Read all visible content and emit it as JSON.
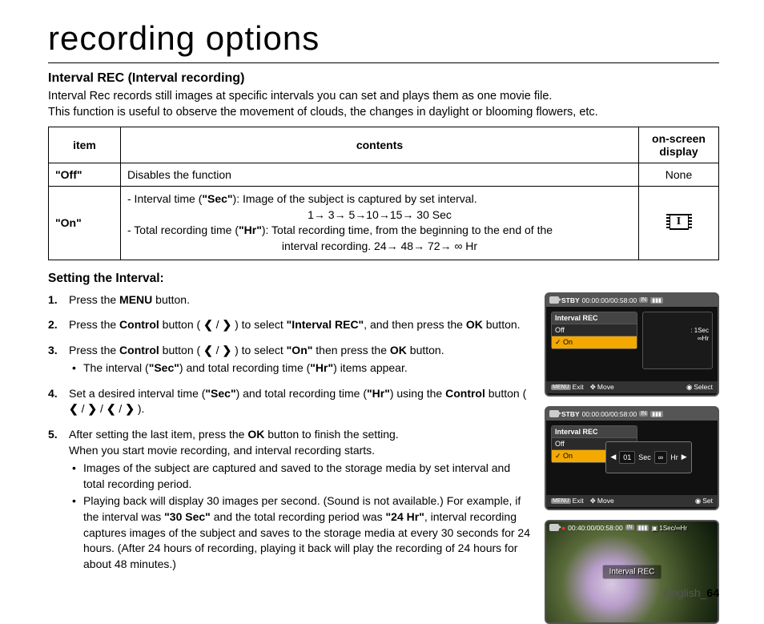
{
  "page": {
    "title": "recording options",
    "footer_lang": "English",
    "footer_page": "64"
  },
  "section": {
    "heading": "Interval REC (Interval recording)",
    "intro1": "Interval Rec records still images at specific intervals you can set and plays them as one movie file.",
    "intro2": "This function is useful to observe the movement of clouds, the changes in daylight or blooming flowers, etc."
  },
  "table": {
    "headers": {
      "item": "item",
      "contents": "contents",
      "display": "on-screen display"
    },
    "rows": {
      "off": {
        "item": "\"Off\"",
        "contents": "Disables the function",
        "display": "None"
      },
      "on": {
        "item": "\"On\"",
        "line1a": "-  Interval time (",
        "line1b": "\"Sec\"",
        "line1c": "): Image of the subject is captured by set interval.",
        "line2": "1→ 3→ 5→10→15→ 30 Sec",
        "line3a": "-  Total recording time (",
        "line3b": "\"Hr\"",
        "line3c": "): Total recording time, from the beginning to the end of the",
        "line4": "interval recording. 24→ 48→ 72→ ∞ Hr"
      }
    }
  },
  "setting": {
    "heading": "Setting the Interval:",
    "step1a": "Press the ",
    "step1b": "MENU",
    "step1c": " button.",
    "step2a": "Press the ",
    "step2b": "Control",
    "step2c": " button ( ",
    "step2d": " / ",
    "step2e": " ) to select ",
    "step2f": "\"Interval REC\"",
    "step2g": ", and then press the ",
    "step2h": "OK",
    "step2i": " button.",
    "step3a": "Press the ",
    "step3b": "Control",
    "step3c": " button ( ",
    "step3d": " / ",
    "step3e": " ) to select ",
    "step3f": "\"On\"",
    "step3g": " then press the ",
    "step3h": "OK",
    "step3i": " button.",
    "step3_b1a": "The interval (",
    "step3_b1b": "\"Sec\"",
    "step3_b1c": ") and total recording time (",
    "step3_b1d": "\"Hr\"",
    "step3_b1e": ") items appear.",
    "step4a": "Set a desired interval time (",
    "step4b": "\"Sec\"",
    "step4c": ") and total recording time (",
    "step4d": "\"Hr\"",
    "step4e": ") using the ",
    "step4f": "Control",
    "step4g": " button ( ",
    "step4h": " / ",
    "step4i": " / ",
    "step4j": " / ",
    "step4k": " ).",
    "step5a": "After setting the last item, press the ",
    "step5b": "OK",
    "step5c": " button to finish the setting.",
    "step5d": "When you start movie recording, and interval recording starts.",
    "step5_b1": "Images of the subject are captured and saved to the storage media by set interval and total recording period.",
    "step5_b2a": "Playing back will display 30 images per second. (Sound is not available.) For example, if the interval was ",
    "step5_b2b": "\"30 Sec\"",
    "step5_b2c": " and the total recording period was ",
    "step5_b2d": "\"24 Hr\"",
    "step5_b2e": ", interval recording captures images of the subject and saves to the storage media at every 30 seconds for 24 hours. (After 24 hours of recording, playing it back will play the recording of 24 hours for about 48 minutes.)"
  },
  "screens": {
    "s1": {
      "stby": "STBY",
      "time": "00:00:00/00:58:00",
      "menu_title": "Interval REC",
      "opt_off": "Off",
      "opt_on": "On",
      "side1": "1Sec",
      "side2": "∞Hr",
      "bot1": "Exit",
      "bot1k": "MENU",
      "bot2": "Move",
      "bot3": "Select"
    },
    "s2": {
      "stby": "STBY",
      "time": "00:00:00/00:58:00",
      "menu_title": "Interval REC",
      "opt_off": "Off",
      "opt_on": "On",
      "pop_sec_val": "01",
      "pop_sec": "Sec",
      "pop_hr_val": "∞",
      "pop_hr": "Hr",
      "bot1": "Exit",
      "bot1k": "MENU",
      "bot2": "Move",
      "bot3": "Set"
    },
    "s3": {
      "time": "00:40:00/00:58:00",
      "tag": "1Sec/∞Hr",
      "label": "Interval REC"
    }
  }
}
